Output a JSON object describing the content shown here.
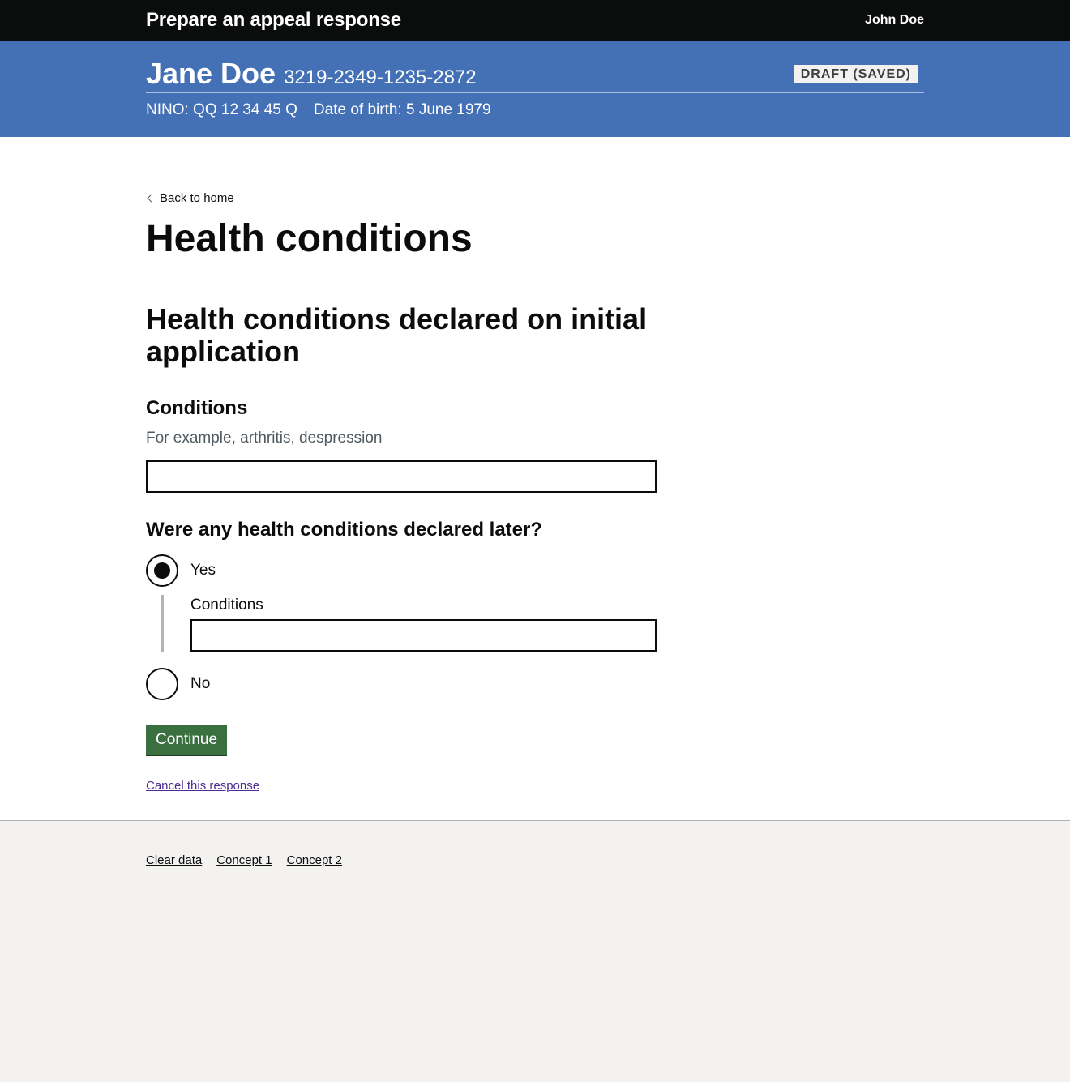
{
  "header": {
    "service_name": "Prepare an appeal response",
    "user_name": "John Doe"
  },
  "case": {
    "claimant_name": "Jane Doe",
    "reference": "3219-2349-1235-2872",
    "status": "DRAFT (SAVED)",
    "nino": "NINO: QQ 12 34 45 Q",
    "dob": "Date of birth: 5 June 1979"
  },
  "page": {
    "back_link": "Back to home",
    "title": "Health conditions",
    "section_heading": "Health conditions declared on initial application"
  },
  "conditions_field": {
    "label": "Conditions",
    "hint": "For example, arthritis, despression",
    "value": ""
  },
  "later_question": {
    "legend": "Were any health conditions declared later?",
    "options": [
      {
        "label": "Yes",
        "selected": true
      },
      {
        "label": "No",
        "selected": false
      }
    ],
    "conditional_label": "Conditions",
    "conditional_value": ""
  },
  "actions": {
    "continue": "Continue",
    "cancel": "Cancel this response"
  },
  "footer": {
    "links": [
      "Clear data",
      "Concept 1",
      "Concept 2"
    ]
  },
  "colors": {
    "header_bg": "#0b0c0c",
    "case_banner_bg": "#4470b6",
    "button_green": "#3a7040",
    "visited_link": "#4c2c92"
  }
}
